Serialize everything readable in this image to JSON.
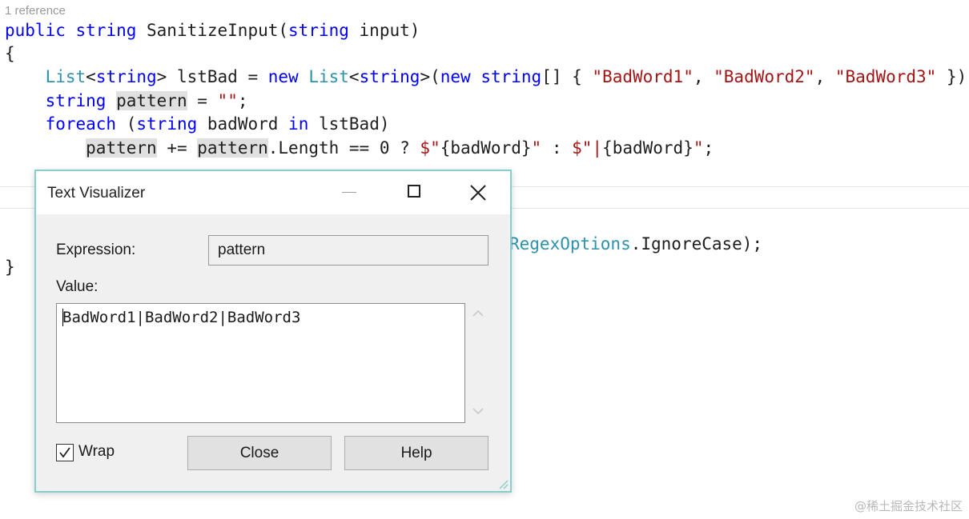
{
  "editor": {
    "codelens": "1 reference",
    "lines": {
      "l1": {
        "kw1": "public",
        "kw2": "string",
        "rest": " SanitizeInput(",
        "kw3": "string",
        "tail": " input)"
      },
      "l2": "{",
      "l3": {
        "t1": "List",
        "p1": "<",
        "k1": "string",
        "p2": "> lstBad = ",
        "k2": "new",
        "t2": "List",
        "p3": "<",
        "k3": "string",
        "p4": ">(",
        "k4": "new",
        "k5": "string",
        "p5": "[] { ",
        "s1": "\"BadWord1\"",
        "c1": ", ",
        "s2": "\"BadWord2\"",
        "c2": ", ",
        "s3": "\"BadWord3\"",
        "end": " });"
      },
      "l4": {
        "k1": "string",
        "hl": "pattern",
        "mid": " = ",
        "s1": "\"\"",
        "end": ";"
      },
      "l5": {
        "k1": "foreach",
        "p1": " (",
        "k2": "string",
        "p2": " badWord ",
        "k3": "in",
        "end": " lstBad)"
      },
      "l6": {
        "hl1": "pattern",
        "mid": " += ",
        "hl2": "pattern",
        "rest": ".Length == 0 ? ",
        "s1": "$\"",
        "i1": "{badWord}",
        "s2": "\"",
        "mid2": " : ",
        "s3": "$\"|",
        "i2": "{badWord}",
        "s4": "\"",
        "end": ";"
      },
      "l7": {
        "t1": "RegexOptions",
        "end": ".IgnoreCase);"
      },
      "l8": "}"
    }
  },
  "dialog": {
    "title": "Text Visualizer",
    "expression_label": "Expression:",
    "expression_value": "pattern",
    "value_label": "Value:",
    "value_text": "BadWord1|BadWord2|BadWord3",
    "wrap_label": "Wrap",
    "wrap_checked": true,
    "close_button": "Close",
    "help_button": "Help",
    "accent_color": "#86cfcd"
  },
  "watermark": "@稀土掘金技术社区"
}
